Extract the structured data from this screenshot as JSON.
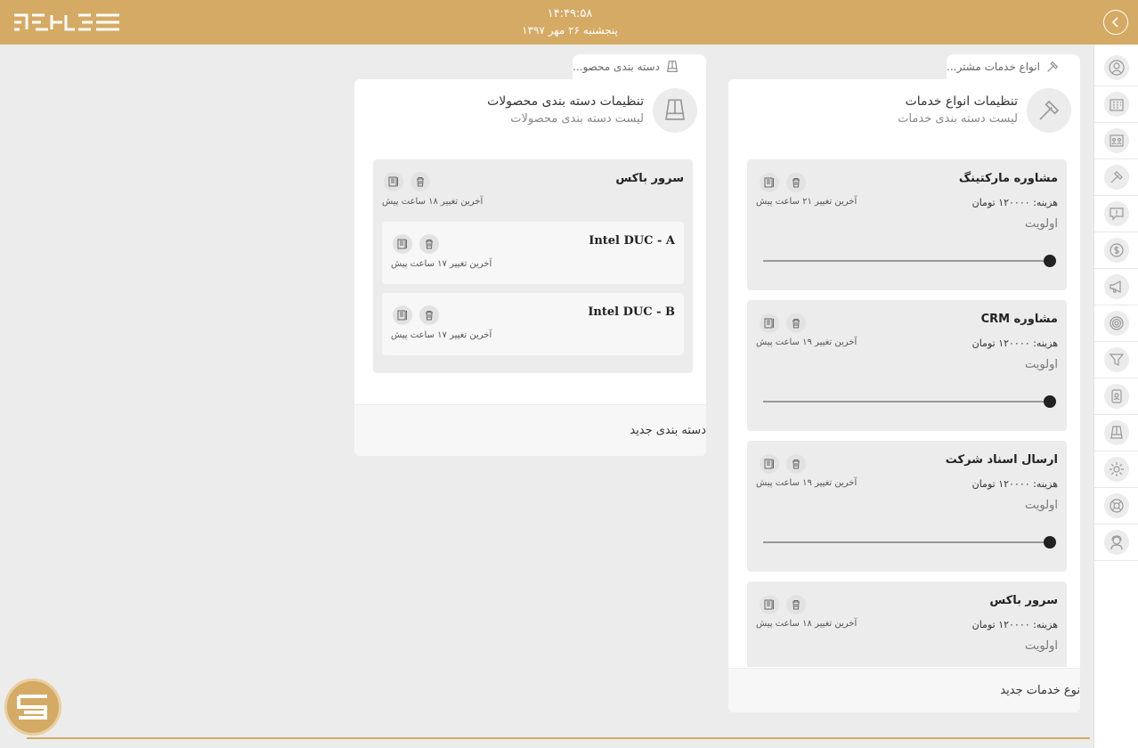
{
  "header": {
    "time": "۱۴:۴۹:۵۸",
    "date": "پنجشنبه ۲۶ مهر ۱۳۹۷"
  },
  "sidebar": {
    "items": [
      {
        "icon": "users-icon"
      },
      {
        "icon": "building-icon"
      },
      {
        "icon": "team-board-icon"
      },
      {
        "icon": "hammer-icon"
      },
      {
        "icon": "message-alert-icon"
      },
      {
        "icon": "dollar-coin-icon"
      },
      {
        "icon": "megaphone-icon"
      },
      {
        "icon": "target-icon"
      },
      {
        "icon": "filter-icon"
      },
      {
        "icon": "id-badge-icon"
      },
      {
        "icon": "product-box-icon"
      },
      {
        "icon": "gear-icon"
      },
      {
        "icon": "lifebuoy-icon"
      },
      {
        "icon": "support-agent-icon"
      }
    ]
  },
  "tabs": {
    "services": "انواع خدمات مشتر...",
    "products": "دسته بندی محصو..."
  },
  "services_panel": {
    "title": "تنظیمات انواع خدمات",
    "subtitle": "لیست دسته بندی خدمات",
    "priority_label": "اولویت",
    "cards": [
      {
        "title": "مشاوره مارکتینگ",
        "cost": "هزینه: ۱۲۰۰۰۰ تومان",
        "modified": "آخرین تغییر ۲۱ ساعت پیش"
      },
      {
        "title": "مشاوره CRM",
        "cost": "هزینه: ۱۲۰۰۰۰ تومان",
        "modified": "آخرین تغییر ۱۹ ساعت پیش"
      },
      {
        "title": "ارسال اسناد شرکت",
        "cost": "هزینه: ۱۲۰۰۰۰ تومان",
        "modified": "آخرین تغییر ۱۹ ساعت پیش"
      },
      {
        "title": "سرور باکس",
        "cost": "هزینه: ۱۲۰۰۰۰ تومان",
        "modified": "آخرین تغییر ۱۸ ساعت پیش"
      }
    ],
    "new_button": "نوع خدمات جدید"
  },
  "products_panel": {
    "title": "تنظیمات دسته بندی محصولات",
    "subtitle": "لیست دسته بندی محصولات",
    "category": {
      "title": "سرور باکس",
      "modified": "آخرین تغییر ۱۸ ساعت پیش",
      "items": [
        {
          "title": "Intel DUC - A",
          "modified": "آخرین تغییر ۱۷ ساعت پیش"
        },
        {
          "title": "Intel DUC - B",
          "modified": "آخرین تغییر ۱۷ ساعت پیش"
        }
      ]
    },
    "new_button": "دسته بندی جدید"
  },
  "colors": {
    "accent": "#d4aa64",
    "background": "#ececec"
  }
}
